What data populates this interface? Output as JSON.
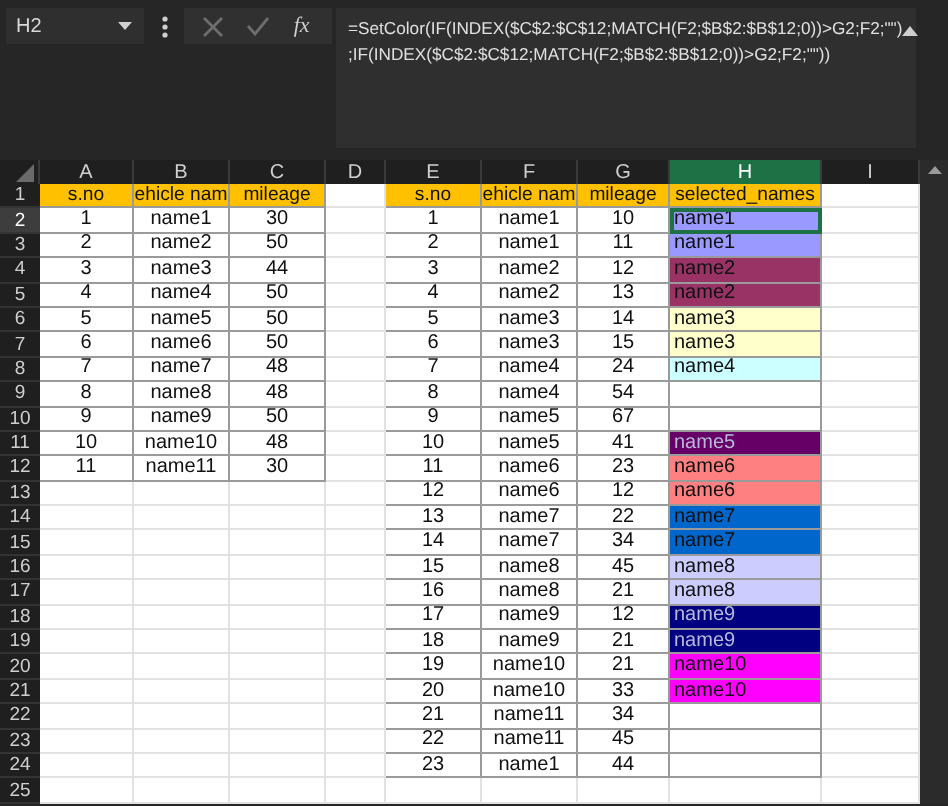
{
  "name_box": "H2",
  "fx_label": "fx",
  "formula_lines": [
    "=SetColor(IF(INDEX($C$2:$C$12;MATCH(F2;$B$2:$B$12;0))>G2;F2;\"\")",
    ";IF(INDEX($C$2:$C$12;MATCH(F2;$B$2:$B$12;0))>G2;F2;\"\"))"
  ],
  "columns": [
    {
      "label": "A",
      "selected": false
    },
    {
      "label": "B",
      "selected": false
    },
    {
      "label": "C",
      "selected": false
    },
    {
      "label": "D",
      "selected": false
    },
    {
      "label": "E",
      "selected": false
    },
    {
      "label": "F",
      "selected": false
    },
    {
      "label": "G",
      "selected": false
    },
    {
      "label": "H",
      "selected": true
    },
    {
      "label": "I",
      "selected": false
    }
  ],
  "row_headers": [
    {
      "label": "1",
      "selected": false
    },
    {
      "label": "2",
      "selected": true
    },
    {
      "label": "3",
      "selected": false
    },
    {
      "label": "4",
      "selected": false
    },
    {
      "label": "5",
      "selected": false
    },
    {
      "label": "6",
      "selected": false
    },
    {
      "label": "7",
      "selected": false
    },
    {
      "label": "8",
      "selected": false
    },
    {
      "label": "9",
      "selected": false
    },
    {
      "label": "10",
      "selected": false
    },
    {
      "label": "11",
      "selected": false
    },
    {
      "label": "12",
      "selected": false
    },
    {
      "label": "13",
      "selected": false
    },
    {
      "label": "14",
      "selected": false
    },
    {
      "label": "15",
      "selected": false
    },
    {
      "label": "16",
      "selected": false
    },
    {
      "label": "17",
      "selected": false
    },
    {
      "label": "18",
      "selected": false
    },
    {
      "label": "19",
      "selected": false
    },
    {
      "label": "20",
      "selected": false
    },
    {
      "label": "21",
      "selected": false
    },
    {
      "label": "22",
      "selected": false
    },
    {
      "label": "23",
      "selected": false
    },
    {
      "label": "24",
      "selected": false
    },
    {
      "label": "25",
      "selected": false
    }
  ],
  "table_1": {
    "columns": [
      "s.no",
      "ehicle nam",
      "mileage"
    ],
    "rows": [
      [
        "1",
        "name1",
        "30"
      ],
      [
        "2",
        "name2",
        "50"
      ],
      [
        "3",
        "name3",
        "44"
      ],
      [
        "4",
        "name4",
        "50"
      ],
      [
        "5",
        "name5",
        "50"
      ],
      [
        "6",
        "name6",
        "50"
      ],
      [
        "7",
        "name7",
        "48"
      ],
      [
        "8",
        "name8",
        "48"
      ],
      [
        "9",
        "name9",
        "50"
      ],
      [
        "10",
        "name10",
        "48"
      ],
      [
        "11",
        "name11",
        "30"
      ]
    ]
  },
  "table_2": {
    "columns": [
      "s.no",
      "ehicle nam",
      "mileage",
      "selected_names"
    ],
    "rows": [
      {
        "s_no": "1",
        "vehicle": "name1",
        "mileage": "10",
        "selected_name": {
          "text": "name1",
          "color": "#9999ff"
        }
      },
      {
        "s_no": "2",
        "vehicle": "name1",
        "mileage": "11",
        "selected_name": {
          "text": "name1",
          "color": "#9999ff"
        }
      },
      {
        "s_no": "3",
        "vehicle": "name2",
        "mileage": "12",
        "selected_name": {
          "text": "name2",
          "color": "#993366"
        }
      },
      {
        "s_no": "4",
        "vehicle": "name2",
        "mileage": "13",
        "selected_name": {
          "text": "name2",
          "color": "#993366"
        }
      },
      {
        "s_no": "5",
        "vehicle": "name3",
        "mileage": "14",
        "selected_name": {
          "text": "name3",
          "color": "#ffffcc"
        }
      },
      {
        "s_no": "6",
        "vehicle": "name3",
        "mileage": "15",
        "selected_name": {
          "text": "name3",
          "color": "#ffffcc"
        }
      },
      {
        "s_no": "7",
        "vehicle": "name4",
        "mileage": "24",
        "selected_name": {
          "text": "name4",
          "color": "#ccffff"
        }
      },
      {
        "s_no": "8",
        "vehicle": "name4",
        "mileage": "54"
      },
      {
        "s_no": "9",
        "vehicle": "name5",
        "mileage": "67"
      },
      {
        "s_no": "10",
        "vehicle": "name5",
        "mileage": "41",
        "selected_name": {
          "text": "name5",
          "color": "#660066"
        }
      },
      {
        "s_no": "11",
        "vehicle": "name6",
        "mileage": "23",
        "selected_name": {
          "text": "name6",
          "color": "#ff8080"
        }
      },
      {
        "s_no": "12",
        "vehicle": "name6",
        "mileage": "12",
        "selected_name": {
          "text": "name6",
          "color": "#ff8080"
        }
      },
      {
        "s_no": "13",
        "vehicle": "name7",
        "mileage": "22",
        "selected_name": {
          "text": "name7",
          "color": "#0066cc"
        }
      },
      {
        "s_no": "14",
        "vehicle": "name7",
        "mileage": "34",
        "selected_name": {
          "text": "name7",
          "color": "#0066cc"
        }
      },
      {
        "s_no": "15",
        "vehicle": "name8",
        "mileage": "45",
        "selected_name": {
          "text": "name8",
          "color": "#ccccff"
        }
      },
      {
        "s_no": "16",
        "vehicle": "name8",
        "mileage": "21",
        "selected_name": {
          "text": "name8",
          "color": "#ccccff"
        }
      },
      {
        "s_no": "17",
        "vehicle": "name9",
        "mileage": "12",
        "selected_name": {
          "text": "name9",
          "color": "#000080"
        }
      },
      {
        "s_no": "18",
        "vehicle": "name9",
        "mileage": "21",
        "selected_name": {
          "text": "name9",
          "color": "#000080"
        }
      },
      {
        "s_no": "19",
        "vehicle": "name10",
        "mileage": "21",
        "selected_name": {
          "text": "name10",
          "color": "#ff00ff"
        }
      },
      {
        "s_no": "20",
        "vehicle": "name10",
        "mileage": "33",
        "selected_name": {
          "text": "name10",
          "color": "#ff00ff"
        }
      },
      {
        "s_no": "21",
        "vehicle": "name11",
        "mileage": "34"
      },
      {
        "s_no": "22",
        "vehicle": "name11",
        "mileage": "45"
      },
      {
        "s_no": "23",
        "vehicle": "name1",
        "mileage": "44"
      }
    ]
  }
}
